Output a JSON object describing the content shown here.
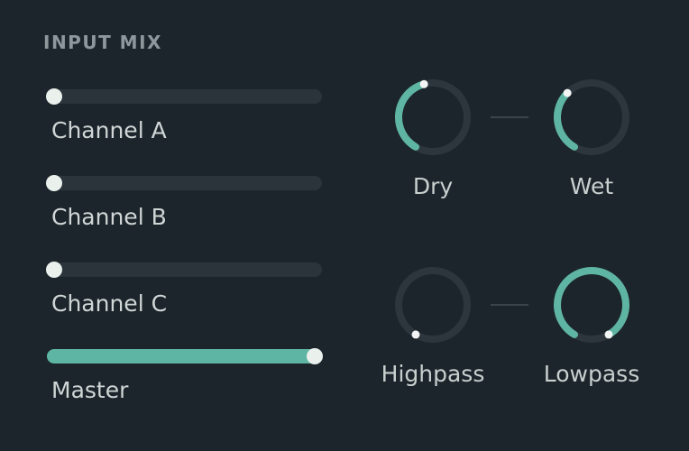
{
  "accent_color": "#5fb5a3",
  "title": "INPUT MIX",
  "sliders": [
    {
      "label": "Channel A",
      "value": 0.0
    },
    {
      "label": "Channel B",
      "value": 0.0
    },
    {
      "label": "Channel C",
      "value": 0.0
    },
    {
      "label": "Master",
      "value": 1.0
    }
  ],
  "knobs": [
    {
      "label": "Dry",
      "value": 0.45
    },
    {
      "label": "Wet",
      "value": 0.35
    },
    {
      "label": "Highpass",
      "value": 0.0
    },
    {
      "label": "Lowpass",
      "value": 1.0
    }
  ]
}
